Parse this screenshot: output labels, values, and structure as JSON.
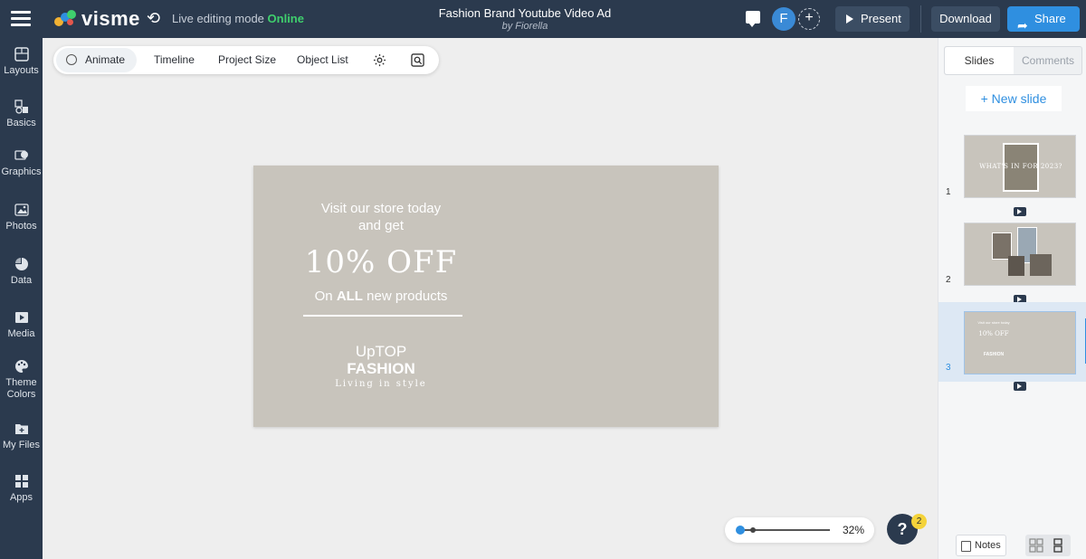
{
  "header": {
    "brand": "visme",
    "mode_label": "Live editing mode",
    "mode_status": "Online",
    "doc_title": "Fashion Brand Youtube Video Ad",
    "doc_author": "by Fiorella",
    "avatar_initial": "F",
    "present_label": "Present",
    "download_label": "Download",
    "share_label": "Share",
    "colors": {
      "bar": "#2b3a4e",
      "accent": "#2f8fe0",
      "online": "#3fcf6d"
    }
  },
  "sidebar": {
    "items": [
      {
        "label": "Layouts",
        "icon": "layout-icon"
      },
      {
        "label": "Basics",
        "icon": "shapes-icon"
      },
      {
        "label": "Graphics",
        "icon": "graphics-icon"
      },
      {
        "label": "Photos",
        "icon": "photo-icon"
      },
      {
        "label": "Data",
        "icon": "pie-chart-icon"
      },
      {
        "label": "Media",
        "icon": "video-icon"
      },
      {
        "label": "Theme",
        "label2": "Colors",
        "icon": "palette-icon"
      },
      {
        "label": "My Files",
        "icon": "folder-icon"
      },
      {
        "label": "Apps",
        "icon": "apps-icon"
      }
    ]
  },
  "toolbar": {
    "animate": "Animate",
    "timeline": "Timeline",
    "project_size": "Project Size",
    "object_list": "Object List"
  },
  "slide": {
    "line1": "Visit our store today",
    "line2": "and get",
    "offer": "10% OFF",
    "products_prefix": "On ",
    "products_bold": "ALL",
    "products_suffix": " new products",
    "brand_line1": "UpTOP",
    "brand_line2": "FASHION",
    "tagline": "Living in style",
    "bg_color": "#c8c4bc"
  },
  "zoom": {
    "percent": "32%",
    "level": 0.32
  },
  "help": {
    "glyph": "?",
    "badge": "2"
  },
  "right_panel": {
    "tab_slides": "Slides",
    "tab_comments": "Comments",
    "new_slide": "+ New slide",
    "slides": [
      {
        "number": "1",
        "title": "WHAT'S IN FOR 2023?"
      },
      {
        "number": "2",
        "title": ""
      },
      {
        "number": "3",
        "title": "",
        "active": true
      }
    ],
    "notes_label": "Notes"
  }
}
